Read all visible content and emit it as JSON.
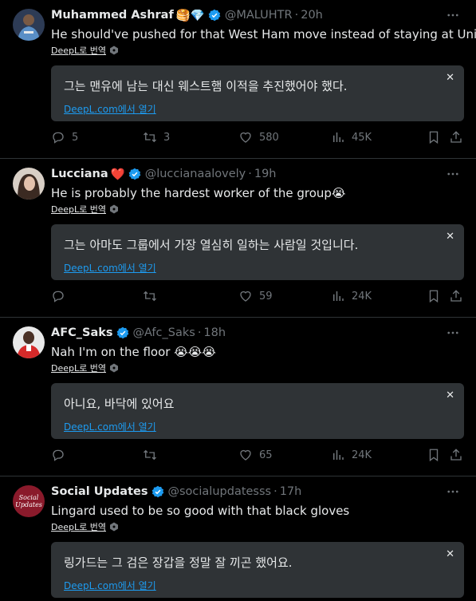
{
  "tweets": [
    {
      "name": "Muhammed Ashraf",
      "emojis": "🥞💎",
      "handle": "@MALUHTR",
      "time": "20h",
      "text": "He should've pushed for that West Ham move instead of staying at United",
      "deepl_label": "DeepL로 번역",
      "translation": "그는 맨유에 남는 대신 웨스트햄 이적을 추진했어야 했다.",
      "deepl_link": "DeepL.com에서 열기",
      "replies": "5",
      "retweets": "3",
      "likes": "580",
      "views": "45K",
      "avatar_color": "#5a8fc6"
    },
    {
      "name": "Lucciana",
      "emojis": "❤️",
      "handle": "@luccianaalovely",
      "time": "19h",
      "text": "He is probably the hardest worker of the group😭",
      "deepl_label": "DeepL로 번역",
      "translation": "그는 아마도 그룹에서 가장 열심히 일하는 사람일 것입니다.",
      "deepl_link": "DeepL.com에서 열기",
      "replies": "",
      "retweets": "",
      "likes": "59",
      "views": "24K",
      "avatar_color": "#c9b4a6"
    },
    {
      "name": "AFC_Saks",
      "emojis": "",
      "handle": "@Afc_Saks",
      "time": "18h",
      "text": "Nah I'm on the floor 😭😭😭",
      "deepl_label": "DeepL로 번역",
      "translation": "아니요, 바닥에 있어요",
      "deepl_link": "DeepL.com에서 열기",
      "replies": "",
      "retweets": "",
      "likes": "65",
      "views": "24K",
      "avatar_color": "#d62a2a"
    },
    {
      "name": "Social Updates",
      "emojis": "",
      "handle": "@socialupdatesss",
      "time": "17h",
      "text": "Lingard used to be so good with that black gloves",
      "deepl_label": "DeepL로 번역",
      "translation": "링가드는 그 검은 장갑을 정말 잘 끼곤 했어요.",
      "deepl_link": "DeepL.com에서 열기",
      "avatar_text": "Social Updates",
      "avatar_color": "#8a1a2b"
    }
  ],
  "colors": {
    "background": "#000000",
    "text": "#e7e9ea",
    "muted": "#71767b",
    "accent": "#1d9bf0",
    "box": "#2f3336"
  }
}
